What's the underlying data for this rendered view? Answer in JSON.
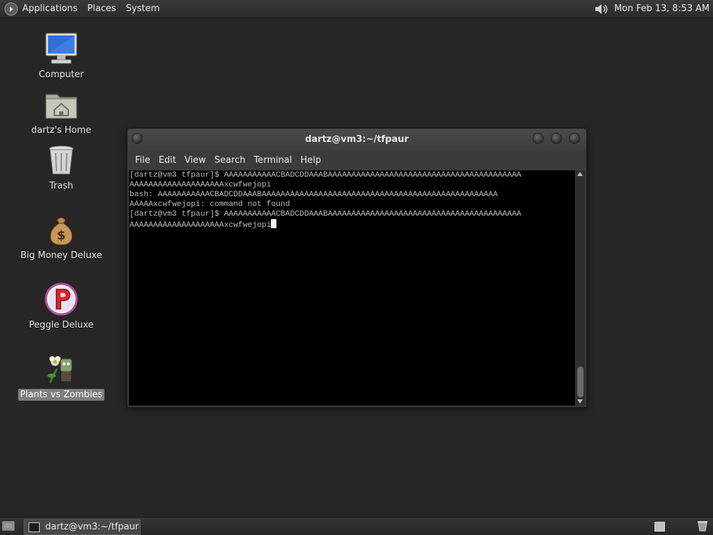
{
  "top_panel": {
    "menus": [
      "Applications",
      "Places",
      "System"
    ],
    "clock": "Mon Feb 13,  8:53 AM"
  },
  "desktop": {
    "icons": [
      {
        "label": "Computer",
        "icon": "computer-icon"
      },
      {
        "label": "dartz's Home",
        "icon": "home-folder-icon"
      },
      {
        "label": "Trash",
        "icon": "trash-icon"
      },
      {
        "label": "Big Money Deluxe",
        "icon": "money-bag-icon"
      },
      {
        "label": "Peggle Deluxe",
        "icon": "peggle-icon"
      },
      {
        "label": "Plants vs Zombies",
        "icon": "plants-vs-zombies-icon",
        "selected": true
      }
    ]
  },
  "terminal": {
    "title": "dartz@vm3:~/tfpaur",
    "menu": [
      "File",
      "Edit",
      "View",
      "Search",
      "Terminal",
      "Help"
    ],
    "lines": [
      "[dartz@vm3 tfpaur]$ AAAAAAAAAAACBADCDDAAABAAAAAAAAAAAAAAAAAAAAAAAAAAAAAAAAAAAAAAAAA",
      "AAAAAAAAAAAAAAAAAAAAxcwfwejopi",
      "bash: AAAAAAAAAAACBADCDDAAABAAAAAAAAAAAAAAAAAAAAAAAAAAAAAAAAAAAAAAAAAAAAAAAAAA",
      "AAAAAxcwfwejopi: command not found",
      "[dartz@vm3 tfpaur]$ AAAAAAAAAAACBADCDDAAABAAAAAAAAAAAAAAAAAAAAAAAAAAAAAAAAAAAAAAAAA",
      "AAAAAAAAAAAAAAAAAAAAxcwfwejopi"
    ]
  },
  "bottom_panel": {
    "task_label": "dartz@vm3:~/tfpaur"
  },
  "colors": {
    "desktop_bg": "#262626",
    "panel_bg": "#2f2f2f",
    "terminal_bg": "#000000",
    "terminal_fg": "#bdbdbd",
    "selection_bg": "#7d7d7d"
  }
}
